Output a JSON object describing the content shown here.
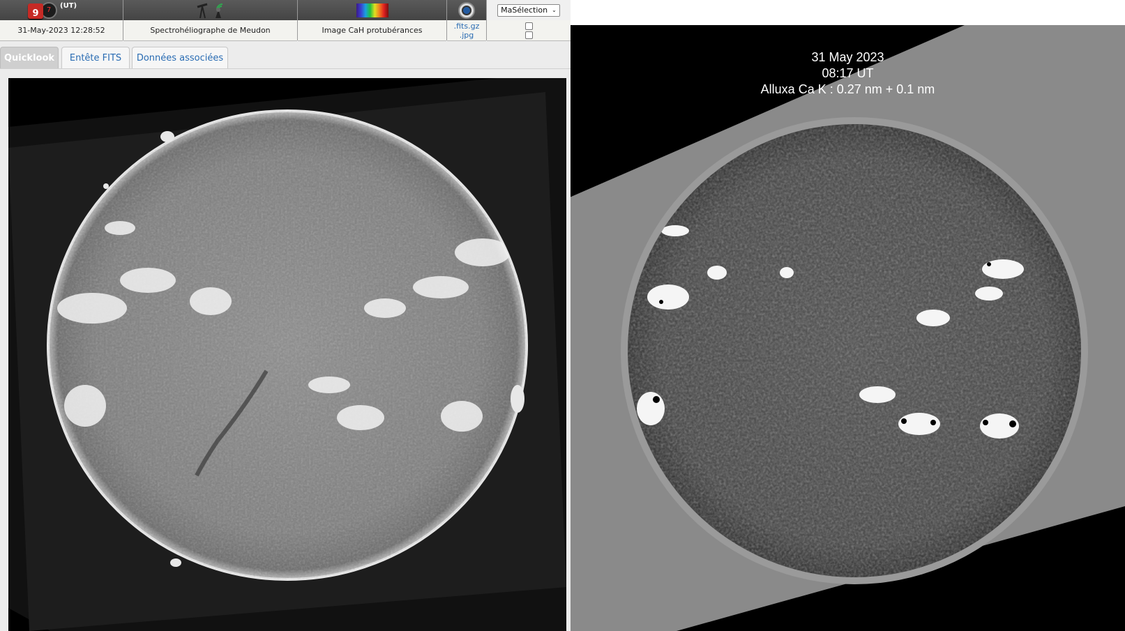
{
  "header": {
    "time_zone_label": "(UT)",
    "calendar_day": "9",
    "datetime": "31-May-2023 12:28:52",
    "instrument": "Spectrohéliographe de Meudon",
    "product": "Image CaH protubérances",
    "file_formats": [
      ".fits.gz",
      ".jpg"
    ],
    "selection_label": "MaSélection"
  },
  "tabs": [
    {
      "label": "Quicklook",
      "active": true
    },
    {
      "label": "Entête FITS",
      "active": false
    },
    {
      "label": "Données associées",
      "active": false
    }
  ],
  "right_image": {
    "date": "31 May 2023",
    "time": "08:17 UT",
    "filter": "Alluxa Ca K : 0.27 nm + 0.1 nm"
  },
  "colors": {
    "header_bar": "#4a4a4a",
    "link": "#2a6cb3",
    "active_tab": "#cfcfcf"
  },
  "icons": {
    "date": "calendar-icon",
    "time": "clock-icon",
    "instrument": "telescope-icon",
    "spectrum": "spectrum-icon",
    "format": "camera-icon"
  }
}
